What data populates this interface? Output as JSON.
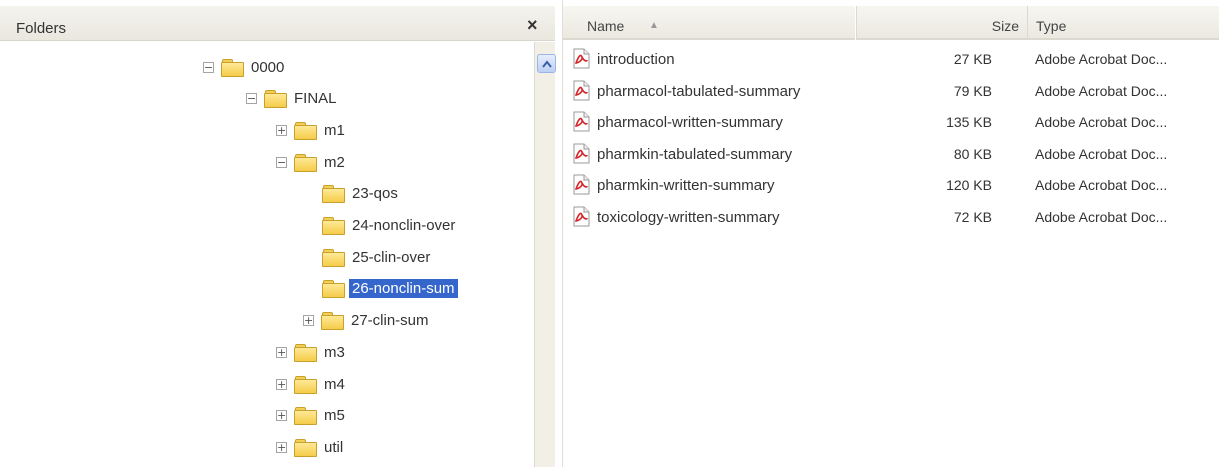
{
  "folders_pane": {
    "title": "Folders",
    "close_label": "×",
    "tree": [
      {
        "label": "0000",
        "expander": "−",
        "depth": 0
      },
      {
        "label": "FINAL",
        "expander": "−",
        "depth": 1
      },
      {
        "label": "m1",
        "expander": "+",
        "depth": 2
      },
      {
        "label": "m2",
        "expander": "−",
        "depth": 2
      },
      {
        "label": "23-qos",
        "expander": "",
        "depth": 3
      },
      {
        "label": "24-nonclin-over",
        "expander": "",
        "depth": 3
      },
      {
        "label": "25-clin-over",
        "expander": "",
        "depth": 3
      },
      {
        "label": "26-nonclin-sum",
        "expander": "",
        "depth": 3,
        "selected": true
      },
      {
        "label": "27-clin-sum",
        "expander": "+",
        "depth": 3
      },
      {
        "label": "m3",
        "expander": "+",
        "depth": 2
      },
      {
        "label": "m4",
        "expander": "+",
        "depth": 2
      },
      {
        "label": "m5",
        "expander": "+",
        "depth": 2
      },
      {
        "label": "util",
        "expander": "+",
        "depth": 2
      }
    ]
  },
  "file_list": {
    "columns": {
      "name": "Name",
      "sort_indicator": "▲",
      "size": "Size",
      "type": "Type"
    },
    "files": [
      {
        "name": "introduction",
        "size": "27 KB",
        "type": "Adobe Acrobat Doc..."
      },
      {
        "name": "pharmacol-tabulated-summary",
        "size": "79 KB",
        "type": "Adobe Acrobat Doc..."
      },
      {
        "name": "pharmacol-written-summary",
        "size": "135 KB",
        "type": "Adobe Acrobat Doc..."
      },
      {
        "name": "pharmkin-tabulated-summary",
        "size": "80 KB",
        "type": "Adobe Acrobat Doc..."
      },
      {
        "name": "pharmkin-written-summary",
        "size": "120 KB",
        "type": "Adobe Acrobat Doc..."
      },
      {
        "name": "toxicology-written-summary",
        "size": "72 KB",
        "type": "Adobe Acrobat Doc..."
      }
    ]
  },
  "colors": {
    "selection": "#3466cc",
    "folder": "#f5cc4a",
    "pdf_red": "#d4262a"
  }
}
